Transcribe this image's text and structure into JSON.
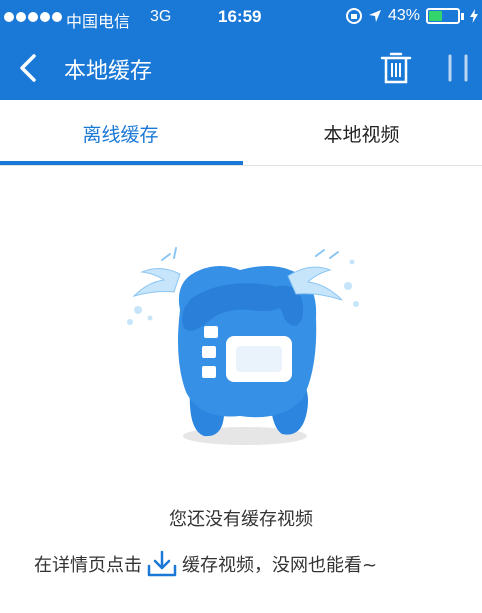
{
  "status_bar": {
    "carrier": "中国电信",
    "network": "3G",
    "time": "16:59",
    "battery": "43%"
  },
  "nav": {
    "title": "本地缓存",
    "back_icon": "chevron-left-icon",
    "trash_icon": "trash-icon",
    "more_icon": "more-icon"
  },
  "tabs": [
    {
      "label": "离线缓存",
      "active": true
    },
    {
      "label": "本地视频",
      "active": false
    }
  ],
  "empty_state": {
    "title": "您还没有缓存视频",
    "hint_before": "在详情页点击",
    "hint_after": "缓存视频，没网也能看~"
  },
  "colors": {
    "accent": "#1a78d6",
    "text": "#333333",
    "battery": "#33d46b"
  }
}
